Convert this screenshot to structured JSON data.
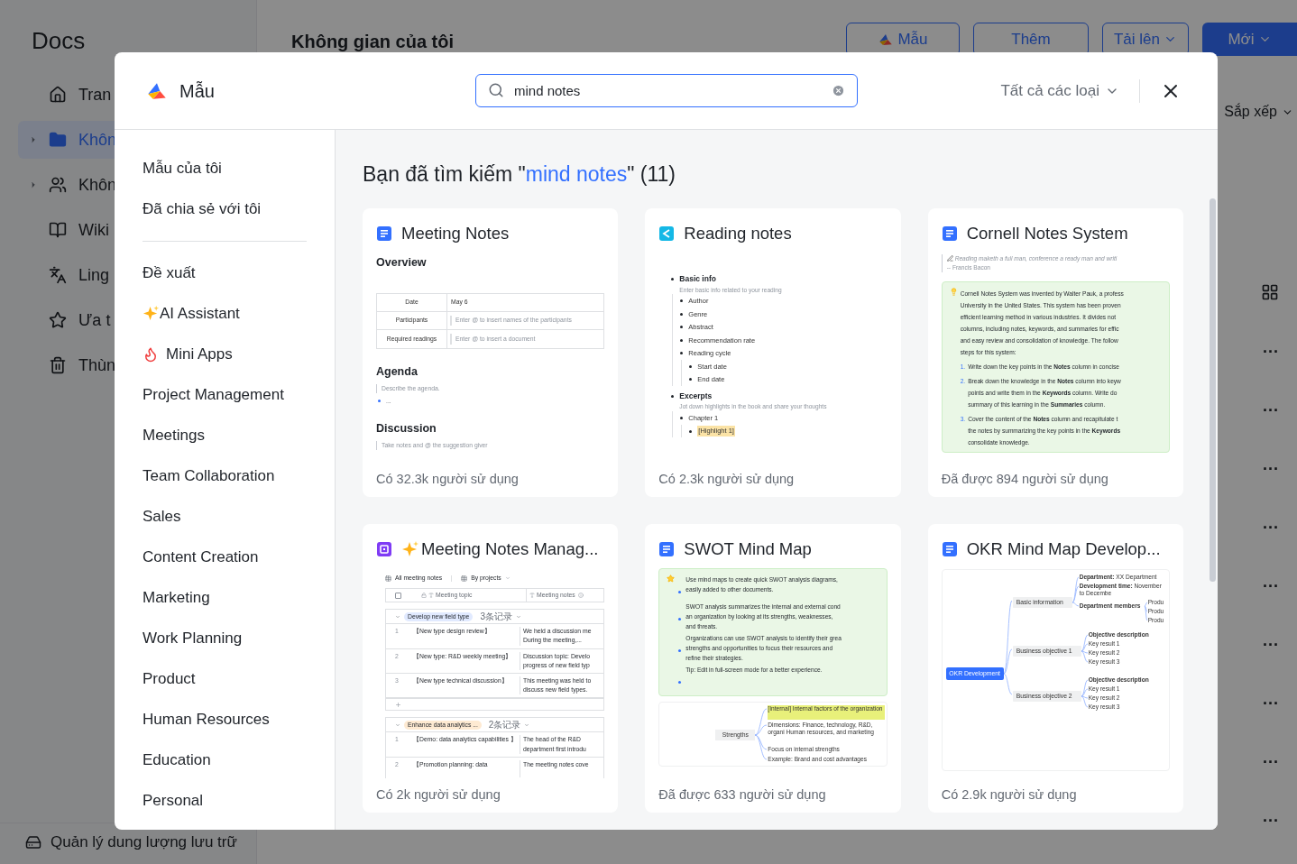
{
  "background": {
    "app_name": "Docs",
    "sidebar": [
      {
        "label": "Tran",
        "kind": "home",
        "expandable": false,
        "selected": false
      },
      {
        "label": "Khôn",
        "kind": "folder",
        "expandable": true,
        "selected": true
      },
      {
        "label": "Khôn",
        "kind": "people",
        "expandable": true,
        "selected": false
      },
      {
        "label": "Wiki",
        "kind": "wiki",
        "expandable": false,
        "selected": false
      },
      {
        "label": "Ling",
        "kind": "lingo",
        "expandable": false,
        "selected": false
      },
      {
        "label": "Ưa t",
        "kind": "star",
        "expandable": false,
        "selected": false
      },
      {
        "label": "Thùn",
        "kind": "trash",
        "expandable": false,
        "selected": false
      }
    ],
    "storage_link": "Quản lý dung lượng lưu trữ",
    "page_title": "Không gian của tôi",
    "buttons": [
      {
        "label": "Mẫu",
        "kind": "template"
      },
      {
        "label": "Thêm",
        "kind": "plain"
      },
      {
        "label": "Tải lên",
        "kind": "dropdown"
      },
      {
        "label": "Mới",
        "kind": "primary"
      }
    ],
    "sort": "Sắp xếp",
    "row_menus": [
      "···",
      "···",
      "···",
      "···",
      "···",
      "···",
      "···",
      "···",
      "···"
    ]
  },
  "modal": {
    "title": "Mẫu",
    "search": {
      "value": "mind notes"
    },
    "filter": "Tất cả các loại",
    "nav": [
      {
        "items": [
          {
            "label": "Mẫu của tôi",
            "kind": "text"
          },
          {
            "label": "Đã chia sẻ với tôi",
            "kind": "text"
          }
        ]
      },
      {
        "items": [
          {
            "label": "Đề xuất",
            "kind": "text"
          },
          {
            "label": "AI Assistant",
            "kind": "sparkle"
          },
          {
            "label": "Mini Apps",
            "kind": "flame"
          },
          {
            "label": "Project Management",
            "kind": "text"
          },
          {
            "label": "Meetings",
            "kind": "text"
          },
          {
            "label": "Team Collaboration",
            "kind": "text"
          },
          {
            "label": "Sales",
            "kind": "text"
          },
          {
            "label": "Content Creation",
            "kind": "text"
          },
          {
            "label": "Marketing",
            "kind": "text"
          },
          {
            "label": "Work Planning",
            "kind": "text"
          },
          {
            "label": "Product",
            "kind": "text"
          },
          {
            "label": "Human Resources",
            "kind": "text"
          },
          {
            "label": "Education",
            "kind": "text"
          },
          {
            "label": "Personal",
            "kind": "text"
          }
        ]
      }
    ],
    "result": {
      "prefix": "Bạn đã tìm kiếm \"",
      "query": "mind notes",
      "suffix": "\" (11)"
    },
    "cards": [
      {
        "title": "Meeting Notes",
        "kind": "doc",
        "sparkle": false,
        "usage": "Có 32.3k người sử dụng",
        "preview": {
          "kind": "meeting",
          "overview": "Overview",
          "table": [
            {
              "label": "Date",
              "value": "May 6",
              "hint": false
            },
            {
              "label": "Participants",
              "value": "Enter @ to insert names of the participants",
              "hint": true
            },
            {
              "label": "Required readings",
              "value": "Enter @ to insert a document",
              "hint": true
            }
          ],
          "sections": [
            {
              "heading": "Agenda",
              "hint": "Describe the agenda.",
              "bullet": "..."
            },
            {
              "heading": "Discussion",
              "hint": "Take notes and @ the suggestion giver"
            }
          ]
        }
      },
      {
        "title": "Reading notes",
        "kind": "note",
        "sparkle": false,
        "usage": "Có 2.3k người sử dụng",
        "preview": {
          "kind": "outline",
          "items": [
            {
              "text": "Basic info",
              "hint": "Enter basic info related to your reading",
              "children": [
                {
                  "text": "Author"
                },
                {
                  "text": "Genre"
                },
                {
                  "text": "Abstract"
                },
                {
                  "text": "Recommendation rate"
                },
                {
                  "text": "Reading cycle",
                  "children": [
                    {
                      "text": "Start date"
                    },
                    {
                      "text": "End date"
                    }
                  ]
                }
              ]
            },
            {
              "text": "Excerpts",
              "hint": "Jot down highlights in the book and share your thoughts",
              "children": [
                {
                  "text": "Chapter 1",
                  "children": [
                    {
                      "text": "[Highlight 1]",
                      "highlighted": true
                    }
                  ]
                }
              ]
            }
          ]
        }
      },
      {
        "title": "Cornell Notes System",
        "kind": "doc",
        "sparkle": false,
        "usage": "Đã được 894 người sử dụng",
        "preview": {
          "kind": "cornell",
          "quote": "Reading maketh a full man, conference a ready man and writi",
          "author": "-- Francis Bacon",
          "intro": [
            "Cornell Notes System was invented by Walter Pauk, a profess",
            "University in the United States. This system has been proven",
            "efficient learning method in various industries. It divides not",
            "columns, including notes, keywords, and summaries for effic",
            "and easy review and consolidation of knowledge. The follow",
            "steps for this system:"
          ],
          "steps": [
            {
              "number": "1.",
              "lines": [
                "Write down the key points in the **Notes** column in concise"
              ]
            },
            {
              "number": "2.",
              "lines": [
                "Break down the knowledge in the **Notes** column into keyw",
                "points and write them in the **Keywords** column. Write do",
                "summary of this learning in the **Summaries** column."
              ]
            },
            {
              "number": "3.",
              "lines": [
                "Cover the content of the **Notes** column and recapitulate t",
                "the notes by summarizing the key points in the **Keywords**",
                "consolidate knowledge."
              ]
            }
          ]
        }
      },
      {
        "title": "Meeting Notes Manag...",
        "kind": "base",
        "sparkle": true,
        "usage": "Có 2k người sử dụng",
        "preview": {
          "kind": "base",
          "views": [
            "All meeting notes",
            "By projects"
          ],
          "select_all": {
            "checked": false
          },
          "columns": [
            "Meeting topic",
            "Meeting notes"
          ],
          "groups": [
            {
              "tag": "Develop new field type",
              "color": "#e1eaff",
              "count": "3条记录",
              "add_row": true,
              "rows": [
                {
                  "number": "1",
                  "topic": "【New type design review】",
                  "notes": [
                    "We held a discussion me",
                    "During the meeting,..."
                  ]
                },
                {
                  "number": "2",
                  "topic": "【New type: R&D weekly meeting】",
                  "notes": [
                    "Discussion topic: Develo",
                    "progress of new field typ"
                  ]
                },
                {
                  "number": "3",
                  "topic": "【New type technical discussion】",
                  "notes": [
                    "This meeting was held to",
                    "discuss new field types."
                  ]
                }
              ]
            },
            {
              "tag": "Enhance data analytics ...",
              "color": "#feead2",
              "count": "2条记录",
              "add_row": false,
              "rows": [
                {
                  "number": "1",
                  "topic": "【Demo: data analytics capabilities 】",
                  "notes": [
                    "The head of the R&D",
                    "department first introdu"
                  ]
                },
                {
                  "number": "2",
                  "topic": "【Promotion planning: data",
                  "notes": [
                    "The meeting notes cove"
                  ]
                }
              ]
            }
          ]
        }
      },
      {
        "title": "SWOT Mind Map",
        "kind": "doc",
        "sparkle": false,
        "usage": "Đã được 633 người sử dụng",
        "preview": {
          "kind": "swot",
          "bullets": [
            {
              "lines": [
                "Use mind maps to create quick SWOT analysis diagrams,",
                "easily added to other documents."
              ]
            },
            {
              "lines": [
                "SWOT analysis summarizes the internal and external cond",
                "an organization  by looking at its strengths, weaknesses,",
                "and threats."
              ]
            },
            {
              "lines": [
                "Organizations can use SWOT analysis to identify their grea",
                "strengths and opportunities to focus their resources and",
                "refine their strategies."
              ]
            },
            {
              "lines": [
                "Tip: Edit in full-screen mode for a better experience."
              ]
            }
          ],
          "map": {
            "text": "Strengths",
            "children": [
              {
                "text": "[Internal] Internal factors of the organization",
                "highlighted": true
              },
              {
                "text": "Dimensions: Finance, technology, R&D, organi Human resources, and marketing",
                "highlighted": false
              },
              {
                "text": "Focus on internal strengths",
                "highlighted": false
              },
              {
                "text": "Example: Brand and cost advantages",
                "highlighted": false
              }
            ]
          }
        }
      },
      {
        "title": "OKR Mind Map Develop...",
        "kind": "doc",
        "sparkle": false,
        "usage": "Có 2.9k người sử dụng",
        "preview": {
          "kind": "okr",
          "map": {
            "text": "OKR Development",
            "children": [
              {
                "text": "Basic information",
                "children": [
                  {
                    "text": "**Department:** XX Department"
                  },
                  {
                    "text": "**Development time:** November to Decembe"
                  },
                  {
                    "text": "**Department members**",
                    "children": [
                      {
                        "text": "Produ"
                      },
                      {
                        "text": "Produ"
                      },
                      {
                        "text": "Produ"
                      }
                    ]
                  }
                ]
              },
              {
                "text": "Business objective 1",
                "children": [
                  {
                    "text": "**Objective description**"
                  },
                  {
                    "text": "Key result 1"
                  },
                  {
                    "text": "Key result 2"
                  },
                  {
                    "text": "Key result 3"
                  }
                ]
              },
              {
                "text": "Business objective 2",
                "children": [
                  {
                    "text": "**Objective description**"
                  },
                  {
                    "text": "Key result 1"
                  },
                  {
                    "text": "Key result 2"
                  },
                  {
                    "text": "Key result 3"
                  }
                ]
              }
            ]
          }
        }
      }
    ]
  }
}
